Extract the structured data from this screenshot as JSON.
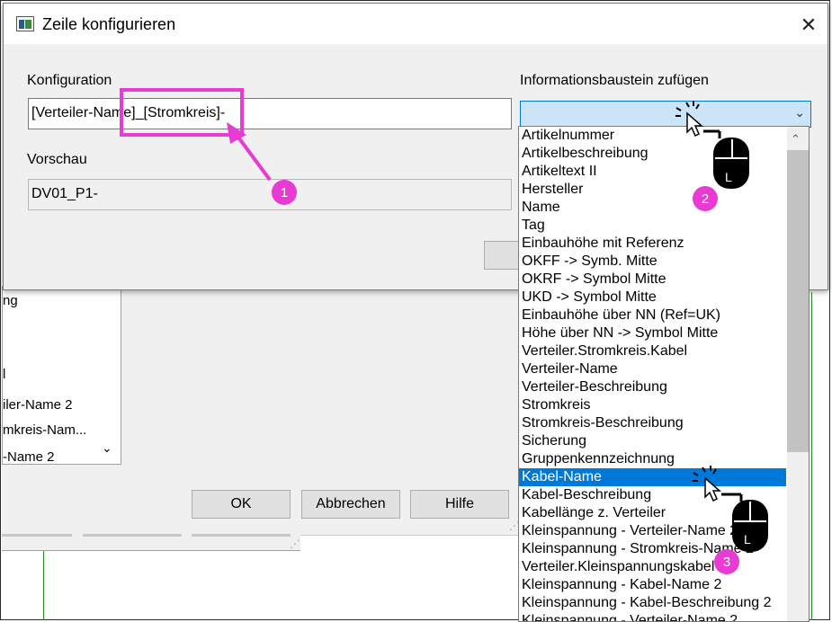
{
  "dialog": {
    "title": "Zeile konfigurieren",
    "konfiguration_label": "Konfiguration",
    "konfiguration_value": "[Verteiler-Name]_[Stromkreis]-",
    "vorschau_label": "Vorschau",
    "vorschau_value": "DV01_P1-",
    "info_label": "Informationsbaustein zufügen",
    "combo_value": ""
  },
  "dropdown": {
    "selected_index": 19,
    "items": [
      "Artikelnummer",
      "Artikelbeschreibung",
      "Artikeltext II",
      "Hersteller",
      "Name",
      "Tag",
      "Einbauhöhe mit Referenz",
      "OKFF -> Symb. Mitte",
      "OKRF -> Symbol Mitte",
      "UKD -> Symbol Mitte",
      "Einbauhöhe über NN (Ref=UK)",
      "Höhe über NN -> Symbol Mitte",
      "Verteiler.Stromkreis.Kabel",
      "Verteiler-Name",
      "Verteiler-Beschreibung",
      "Stromkreis",
      "Stromkreis-Beschreibung",
      "Sicherung",
      "Gruppenkennzeichnung",
      "Kabel-Name",
      "Kabel-Beschreibung",
      "Kabellänge z. Verteiler",
      "Kleinspannung - Verteiler-Name 2",
      "Kleinspannung - Stromkreis-Name 2",
      "Verteiler.Kleinspannungskabel",
      "Kleinspannung - Kabel-Name 2",
      "Kleinspannung - Kabel-Beschreibung 2",
      "Kleinspannung - Verteiler-Name 2"
    ]
  },
  "background": {
    "list_items": [
      "ng",
      "l",
      "iler-Name 2",
      "mkreis-Nam...",
      "-Name 2"
    ],
    "buttons": {
      "ok": "OK",
      "cancel": "Abbrechen",
      "help": "Hilfe"
    }
  },
  "annotations": {
    "badge1": "1",
    "badge2": "2",
    "badge3": "3",
    "mouse_letter": "L",
    "accent_color": "#e73bd4"
  }
}
